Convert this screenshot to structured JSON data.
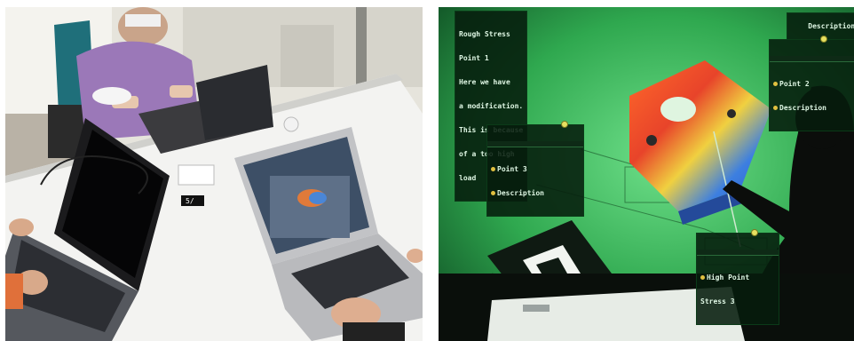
{
  "left_photo": {
    "subject": "collaborative-workspace",
    "marker_label": "5/"
  },
  "right_photo": {
    "hud": {
      "rough_stress": {
        "lines": [
          "Rough Stress",
          "Point 1",
          "Here we have",
          "a modification.",
          "This is because",
          "of a too high",
          "load"
        ]
      },
      "point_2": {
        "lines": [
          "Point 2",
          "Description"
        ]
      },
      "point_3": {
        "lines": [
          "Point 3",
          "Description"
        ]
      },
      "high_point_stress": {
        "lines": [
          "High Point",
          "Stress 3"
        ]
      },
      "top_right_label": "Description"
    },
    "colors": {
      "projection_green": "#2fa84f",
      "stress_red": "#e8442a",
      "stress_blue": "#3d7fe0",
      "hud_bg": "#061c0c"
    }
  }
}
